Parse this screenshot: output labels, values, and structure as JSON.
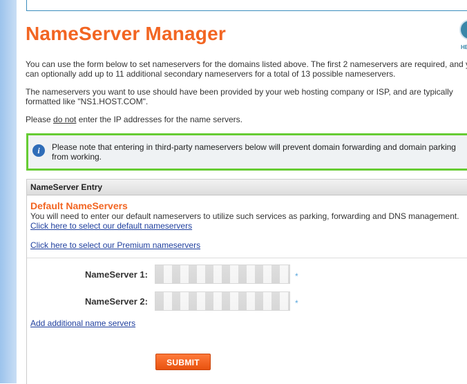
{
  "page": {
    "title": "NameServer Manager",
    "help_label": "HE",
    "help_icon": "help-icon"
  },
  "intro": {
    "line1": "You can use the form below to set nameservers for the domains listed above. The first 2 nameservers are required, and y",
    "line2": "can optionally add up to 11 additional secondary nameservers for a total of 13 possible nameservers.",
    "line3": "The nameservers you want to use should have been provided by your web hosting company or ISP, and are typically",
    "line4": "formatted like \"NS1.HOST.COM\".",
    "please_prefix": "Please ",
    "please_emphasis": "do not",
    "please_suffix": " enter the IP addresses for the name servers."
  },
  "notice": {
    "icon": "info-icon",
    "text": "Please note that entering in third-party nameservers below will prevent domain forwarding and domain parking from working."
  },
  "panel": {
    "header": "NameServer Entry",
    "section_title": "Default NameServers",
    "section_desc": "You will need to enter our default nameservers to utilize such services as parking, forwarding and DNS management.",
    "link_default": "Click here to select our default nameservers",
    "link_premium": "Click here to select our Premium nameservers",
    "fields": [
      {
        "label": "NameServer 1:",
        "value": "",
        "required_mark": "*"
      },
      {
        "label": "NameServer 2:",
        "value": "",
        "required_mark": "*"
      }
    ],
    "link_add": "Add additional name servers",
    "submit_label": "SUBMIT"
  },
  "colors": {
    "accent": "#f26522",
    "notice_border": "#66cc33",
    "link": "#1f3f9e",
    "sidebar": "#9cc3ec"
  }
}
